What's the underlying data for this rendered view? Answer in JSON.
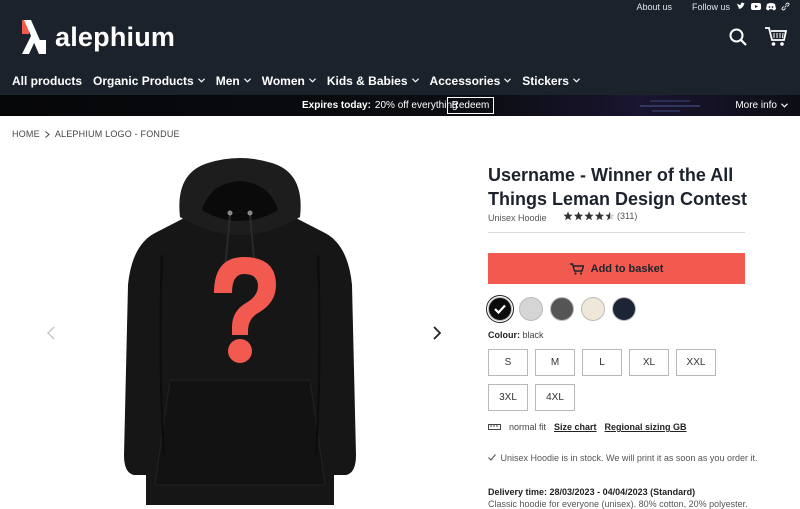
{
  "top_links": {
    "about": "About us",
    "follow": "Follow us"
  },
  "brand": {
    "name": "alephium",
    "accent": "#f35a4f"
  },
  "header_icons": [
    "search-icon",
    "cart-icon"
  ],
  "nav": [
    "All products",
    "Organic Products",
    "Men",
    "Women",
    "Kids & Babies",
    "Accessories",
    "Stickers"
  ],
  "promo": {
    "label": "Expires today:",
    "text": "20% off everything",
    "button": "Redeem",
    "more": "More info"
  },
  "breadcrumb": [
    "HOME",
    "ALEPHIUM LOGO - FONDUE"
  ],
  "product": {
    "title": "Username - Winner of the All Things Leman Design Contest",
    "type": "Unisex Hoodie",
    "rating_stars": 4.5,
    "rating_count": "(311)",
    "basket_label": "Add to basket",
    "colour_label": "Colour:",
    "colour_value": "black",
    "colours": [
      "#0b0b0b",
      "#d5d5d5",
      "#555555",
      "#efe8d8",
      "#1c2436"
    ],
    "sizes": [
      "S",
      "M",
      "L",
      "XL",
      "XXL",
      "3XL",
      "4XL"
    ],
    "fit": "normal fit",
    "size_chart": "Size chart",
    "regional": "Regional sizing GB",
    "stock": "Unisex Hoodie is in stock. We will print it as soon as you order it.",
    "delivery": "Delivery time: 28/03/2023 - 04/04/2023 (Standard)",
    "description": "Classic hoodie for everyone (unisex). 80% cotton, 20% polyester."
  }
}
